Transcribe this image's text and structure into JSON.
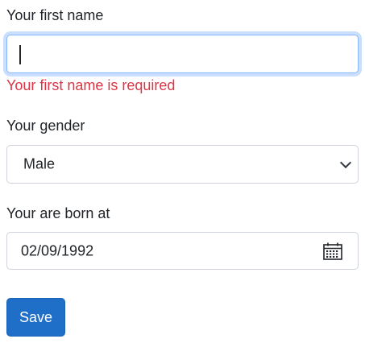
{
  "form": {
    "first_name": {
      "label": "Your first name",
      "value": "",
      "error": "Your first name is required"
    },
    "gender": {
      "label": "Your gender",
      "selected": "Male"
    },
    "birth_date": {
      "label": "Your are born at",
      "value": "02/09/1992"
    },
    "save_label": "Save"
  },
  "colors": {
    "error": "#dc3545",
    "primary_button": "#1f6fc9",
    "focus_border": "#86b7fe"
  },
  "icons": {
    "select": "chevron-down-icon",
    "date": "calendar-icon"
  }
}
